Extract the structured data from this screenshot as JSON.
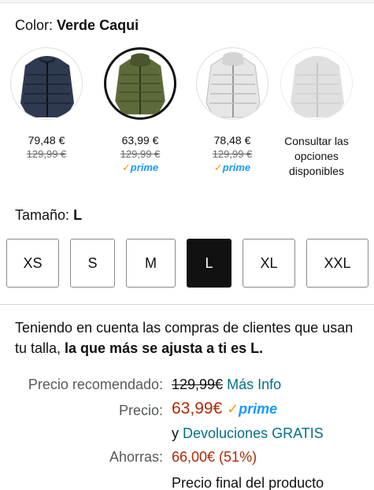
{
  "color": {
    "label": "Color:",
    "value": "Verde Caqui"
  },
  "swatches": [
    {
      "price": "79,48 €",
      "old_price": "129,99 €",
      "prime": "",
      "shirt": "#2e3a4f",
      "selected": false
    },
    {
      "price": "63,99 €",
      "old_price": "129,99 €",
      "prime": "prime",
      "shirt": "#5d6a3a",
      "selected": true
    },
    {
      "price": "78,48 €",
      "old_price": "129,99 €",
      "prime": "prime",
      "shirt": "#e6e6e6",
      "selected": false
    },
    {
      "consult_text": "Consultar las opciones disponibles",
      "shirt": "#c7c7c7",
      "selected": false
    }
  ],
  "size": {
    "label": "Tamaño:",
    "value": "L"
  },
  "sizes": [
    "XS",
    "S",
    "M",
    "L",
    "XL",
    "XXL"
  ],
  "selected_size": "L",
  "fit_note": {
    "prefix": "Teniendo en cuenta las compras de clientes que usan tu talla, ",
    "bold": "la que más se ajusta a ti es L."
  },
  "pricing": {
    "recommended_label": "Precio recomendado:",
    "recommended_value": "129,99€",
    "more_info": "Más Info",
    "price_label": "Precio:",
    "price_value": "63,99€",
    "prime": "prime",
    "returns_prefix": "y",
    "returns_link": "Devoluciones GRATIS",
    "savings_label": "Ahorras:",
    "savings_value": "66,00€ (51%)",
    "final_note": "Precio final del producto"
  },
  "colors": {
    "link": "#007185",
    "price_red": "#b12704",
    "prime_blue": "#1a98ff",
    "prime_check": "#ff9900"
  }
}
